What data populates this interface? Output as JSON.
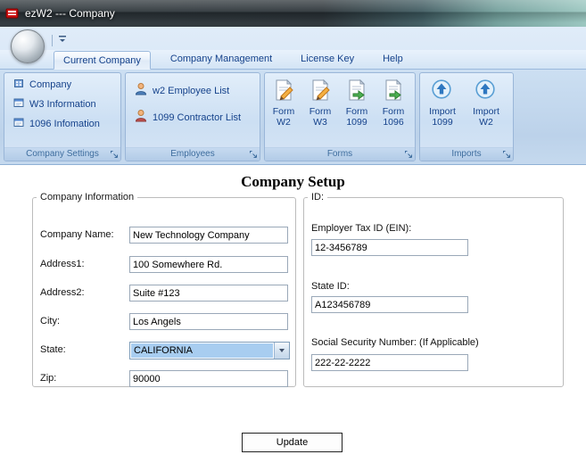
{
  "window": {
    "title": "ezW2 --- Company"
  },
  "tabs": [
    {
      "label": "Current Company",
      "active": true
    },
    {
      "label": "Company Management",
      "active": false
    },
    {
      "label": "License Key",
      "active": false
    },
    {
      "label": "Help",
      "active": false
    }
  ],
  "ribbon": {
    "groups": [
      {
        "label": "Company Settings",
        "items": [
          {
            "label": "Company",
            "icon": "building-icon"
          },
          {
            "label": "W3 Information",
            "icon": "form-window-icon"
          },
          {
            "label": "1096 Infomation",
            "icon": "form-window-icon"
          }
        ]
      },
      {
        "label": "Employees",
        "items": [
          {
            "label": "w2 Employee List",
            "icon": "employee-person-icon"
          },
          {
            "label": "1099 Contractor List",
            "icon": "contractor-person-icon"
          }
        ]
      },
      {
        "label": "Forms",
        "items": [
          {
            "line1": "Form",
            "line2": "W2",
            "icon": "form-edit-icon"
          },
          {
            "line1": "Form",
            "line2": "W3",
            "icon": "form-edit-icon"
          },
          {
            "line1": "Form",
            "line2": "1099",
            "icon": "form-export-icon"
          },
          {
            "line1": "Form",
            "line2": "1096",
            "icon": "form-export-icon"
          }
        ]
      },
      {
        "label": "Imports",
        "items": [
          {
            "line1": "Import",
            "line2": "1099",
            "icon": "import-up-icon"
          },
          {
            "line1": "Import",
            "line2": "W2",
            "icon": "import-up-icon"
          }
        ]
      }
    ]
  },
  "content": {
    "title": "Company Setup",
    "company_info": {
      "legend": "Company Information",
      "fields": [
        {
          "label": "Company Name:",
          "value": "New Technology Company"
        },
        {
          "label": "Address1:",
          "value": "100 Somewhere Rd."
        },
        {
          "label": "Address2:",
          "value": "Suite #123"
        },
        {
          "label": "City:",
          "value": "Los Angels"
        },
        {
          "label": "State:",
          "value": "CALIFORNIA"
        },
        {
          "label": "Zip:",
          "value": "90000"
        }
      ]
    },
    "id_info": {
      "legend": "ID:",
      "fields": [
        {
          "label": "Employer Tax ID (EIN):",
          "value": "12-3456789"
        },
        {
          "label": "State ID:",
          "value": "A123456789"
        },
        {
          "label": "Social Security Number: (If Applicable)",
          "value": "222-22-2222"
        }
      ]
    },
    "update_button": "Update"
  },
  "colors": {
    "ribbon_text": "#15428b",
    "group_caption_text": "#3e6d9e",
    "combo_selection_bg": "#a8cdf0",
    "titlebar_teal": "#96c4bd"
  }
}
